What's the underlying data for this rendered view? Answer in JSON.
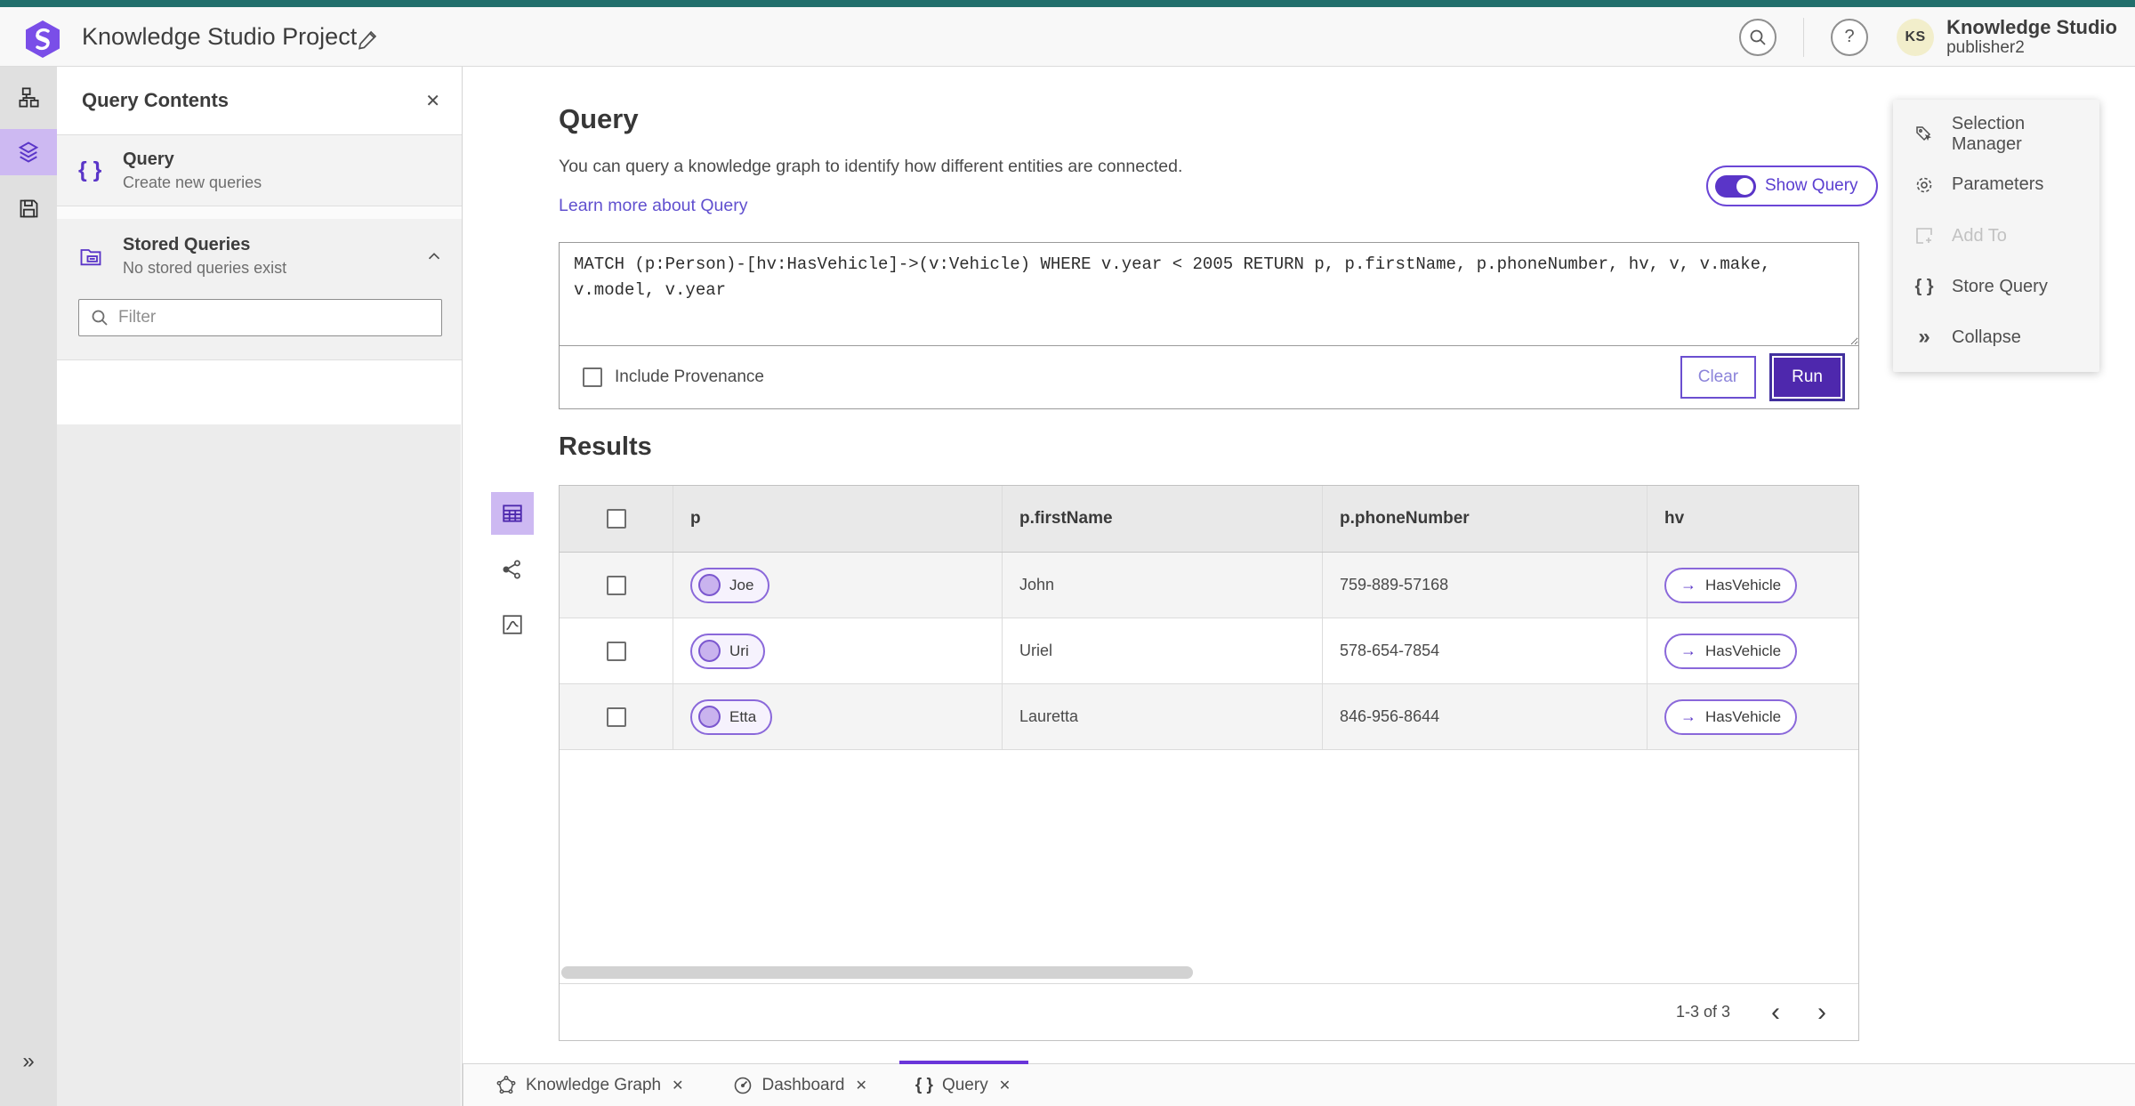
{
  "topbar": {
    "project_title": "Knowledge Studio Project",
    "product_name": "Knowledge Studio",
    "user_name": "publisher2",
    "avatar_initials": "KS"
  },
  "left_panel": {
    "title": "Query Contents",
    "query_item": {
      "label": "Query",
      "description": "Create new queries"
    },
    "stored_item": {
      "label": "Stored Queries",
      "description": "No stored queries exist"
    },
    "filter_placeholder": "Filter"
  },
  "query_section": {
    "title": "Query",
    "description": "You can query a knowledge graph to identify how different entities are connected.",
    "link_label": "Learn more about Query",
    "show_query_label": "Show Query",
    "query_text": "MATCH (p:Person)-[hv:HasVehicle]->(v:Vehicle) WHERE v.year < 2005 RETURN p, p.firstName, p.phoneNumber, hv, v, v.make, v.model, v.year",
    "include_provenance_label": "Include Provenance",
    "clear_label": "Clear",
    "run_label": "Run"
  },
  "results": {
    "title": "Results",
    "columns": [
      "p",
      "p.firstName",
      "p.phoneNumber",
      "hv"
    ],
    "rows": [
      {
        "p": "Joe",
        "firstName": "John",
        "phoneNumber": "759-889-57168",
        "hv": "HasVehicle"
      },
      {
        "p": "Uri",
        "firstName": "Uriel",
        "phoneNumber": "578-654-7854",
        "hv": "HasVehicle"
      },
      {
        "p": "Etta",
        "firstName": "Lauretta",
        "phoneNumber": "846-956-8644",
        "hv": "HasVehicle"
      }
    ],
    "pagination": "1-3 of 3"
  },
  "right_panel": {
    "items": [
      {
        "label": "Selection Manager",
        "disabled": false
      },
      {
        "label": "Parameters",
        "disabled": false
      },
      {
        "label": "Add To",
        "disabled": true
      },
      {
        "label": "Store Query",
        "disabled": false
      },
      {
        "label": "Collapse",
        "disabled": false
      }
    ]
  },
  "tabs": [
    {
      "label": "Knowledge Graph"
    },
    {
      "label": "Dashboard"
    },
    {
      "label": "Query"
    }
  ],
  "icons": {
    "braces": "{ }",
    "help": "?",
    "close": "✕",
    "collapse_chevrons": "»",
    "expand_chevrons": "»",
    "prev_chevron": "‹",
    "next_chevron": "›",
    "arrow_right": "→"
  },
  "colors": {
    "accent_purple": "#5a35c8",
    "deep_purple": "#4e28ad",
    "light_purple_bg": "#cdb9f2",
    "teal_top": "#216f6c",
    "link": "#6150cf",
    "avatar_bg": "#f2eecb"
  }
}
